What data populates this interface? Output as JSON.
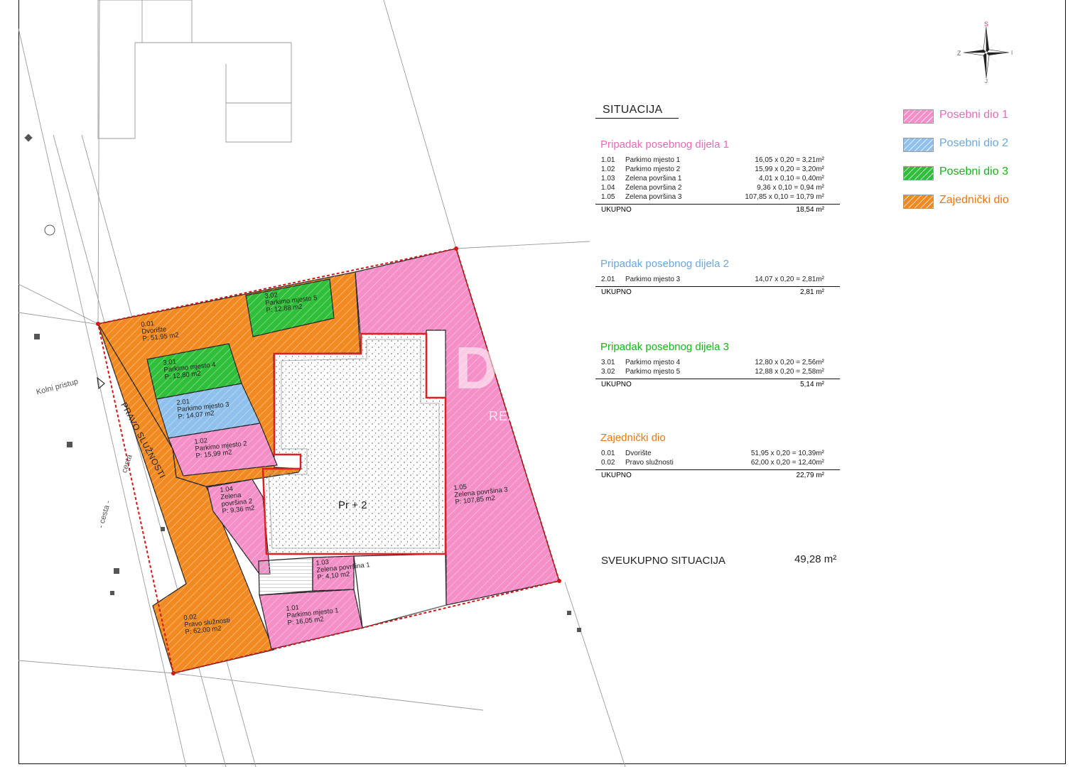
{
  "title": "SITUACIJA",
  "compass": {
    "n": "S",
    "s": "J",
    "w": "Z",
    "e": "I"
  },
  "colors": {
    "pink": "#f48fc8",
    "blue": "#8fc1ec",
    "green": "#2fbf3a",
    "orange": "#f28a22",
    "pink_text": "#e66bb8",
    "blue_text": "#6aa8df",
    "green_text": "#18b318",
    "orange_text": "#e87813"
  },
  "sections": [
    {
      "title": "Pripadak posebnog dijela 1",
      "color": "pink_text",
      "rows": [
        {
          "code": "1.01",
          "name": "Parkimo mjesto 1",
          "value": "16,05 x 0,20 = 3,21m²"
        },
        {
          "code": "1.02",
          "name": "Parkimo mjesto 2",
          "value": "15,99 x 0,20 = 3,20m²"
        },
        {
          "code": "1.03",
          "name": "Zelena površina 1",
          "value": "4,01 x 0,10 = 0,40m²"
        },
        {
          "code": "1.04",
          "name": "Zelena površina 2",
          "value": "9,36 x 0,10 = 0,94 m²"
        },
        {
          "code": "1.05",
          "name": "Zelena površina 3",
          "value": "107,85 x 0,10 = 10,79 m²"
        }
      ],
      "total_label": "UKUPNO",
      "total": "18,54 m²"
    },
    {
      "title": "Pripadak posebnog dijela 2",
      "color": "blue_text",
      "rows": [
        {
          "code": "2.01",
          "name": "Parkimo mjesto 3",
          "value": "14,07 x 0,20 = 2,81m²"
        }
      ],
      "total_label": "UKUPNO",
      "total": "2,81 m²"
    },
    {
      "title": "Pripadak posebnog dijela 3",
      "color": "green_text",
      "rows": [
        {
          "code": "3.01",
          "name": "Parkimo mjesto 4",
          "value": "12,80 x 0,20 = 2,56m²"
        },
        {
          "code": "3.02",
          "name": "Parkimo mjesto 5",
          "value": "12,88 x 0,20 = 2,58m²"
        }
      ],
      "total_label": "UKUPNO",
      "total": "5,14 m²"
    },
    {
      "title": "Zajednički dio",
      "color": "orange_text",
      "rows": [
        {
          "code": "0.01",
          "name": "Dvorište",
          "value": "51,95 x 0,20 = 10,39m²"
        },
        {
          "code": "0.02",
          "name": "Pravo služnosti",
          "value": "62,00 x 0,20 = 12,40m²"
        }
      ],
      "total_label": "UKUPNO",
      "total": "22,79 m²"
    }
  ],
  "grand_total": {
    "label": "SVEUKUPNO SITUACIJA",
    "value": "49,28 m²"
  },
  "legend": [
    {
      "label": "Posebni dio 1",
      "fill": "pink",
      "text": "pink_text"
    },
    {
      "label": "Posebni dio 2",
      "fill": "blue",
      "text": "blue_text"
    },
    {
      "label": "Posebni dio 3",
      "fill": "green",
      "text": "green_text"
    },
    {
      "label": "Zajednički dio",
      "fill": "orange",
      "text": "orange_text"
    }
  ],
  "map_labels": {
    "p001": [
      "0.01",
      "Dvorište",
      "P: 51,95 m2"
    ],
    "p302": [
      "3.02",
      "Parkimo mjesto 5",
      "P: 12,88 m2"
    ],
    "p301": [
      "3.01",
      "Parkimo mjesto 4",
      "P: 12,80 m2"
    ],
    "p201": [
      "2.01",
      "Parkimo mjesto 3",
      "P: 14,07 m2"
    ],
    "p102": [
      "1.02",
      "Parkimo mjesto 2",
      "P: 15,99 m2"
    ],
    "p104": [
      "1.04",
      "Zelena",
      "površina 2",
      "P: 9,36 m2"
    ],
    "p103": [
      "1.03",
      "Zelena površina 1",
      "P: 4,10 m2"
    ],
    "p101": [
      "1.01",
      "Parkimo mjesto 1",
      "P: 16,05 m2"
    ],
    "p105": [
      "1.05",
      "Zelena površina 3",
      "P: 107,85 m2"
    ],
    "p002": [
      "0.02",
      "Pravo služnosti",
      "P: 62,00 m2"
    ],
    "building": "Pr + 2",
    "easement": "PRAVO SLUŽNOSTI",
    "access": "Kolni pristup",
    "road": "cesta",
    "road2": "- cesta -"
  },
  "watermark": {
    "brand": "DUX",
    "sub": "REAL ESTATE"
  }
}
